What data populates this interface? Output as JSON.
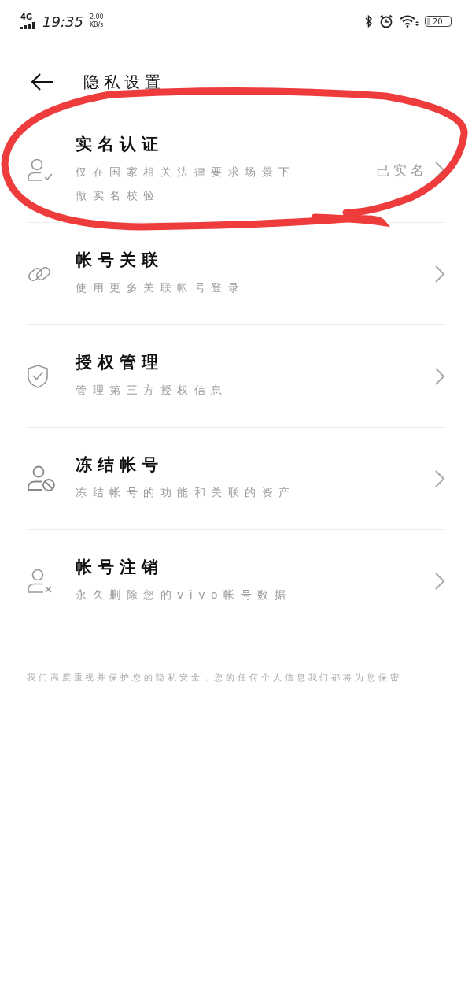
{
  "status_bar": {
    "network": "4G",
    "time": "19:35",
    "speed": "2.00",
    "speed_unit": "KB/s",
    "battery": "20"
  },
  "header": {
    "title": "隐私设置"
  },
  "items": [
    {
      "kind": "user-check",
      "title": "实名认证",
      "subtitle": "仅在国家相关法律要求场景下做实名校验",
      "value": "已实名",
      "circled": true
    },
    {
      "kind": "link",
      "title": "帐号关联",
      "subtitle": "使用更多关联帐号登录",
      "circled": false
    },
    {
      "kind": "shield",
      "title": "授权管理",
      "subtitle": "管理第三方授权信息",
      "circled": false
    },
    {
      "kind": "user-block",
      "title": "冻结帐号",
      "subtitle": "冻结帐号的功能和关联的资产",
      "circled": false
    },
    {
      "kind": "user-x",
      "title": "帐号注销",
      "subtitle": "永久删除您的vivo帐号数据",
      "circled": false
    }
  ],
  "footer": "我们高度重视并保护您的隐私安全，您的任何个人信息我们都将为您保密"
}
